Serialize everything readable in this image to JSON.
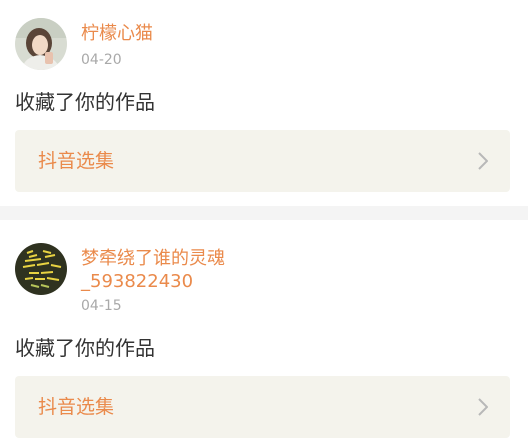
{
  "notifications": [
    {
      "username": "柠檬心猫",
      "date": "04-20",
      "message": "收藏了你的作品",
      "work_title": "抖音选集",
      "icons": {
        "avatar": "avatar-photo",
        "arrow": "chevron-right-icon"
      }
    },
    {
      "username_line1": "梦牵绕了谁的灵魂",
      "username_line2": "_593822430",
      "date": "04-15",
      "message": "收藏了你的作品",
      "work_title": "抖音选集",
      "icons": {
        "avatar": "avatar-calligraphy",
        "arrow": "chevron-right-icon"
      }
    }
  ],
  "colors": {
    "accent": "#ea8a4b",
    "date": "#a9a9a9",
    "text": "#333333",
    "work_bg": "#f4f3ec",
    "divider": "#f4f4f4"
  }
}
